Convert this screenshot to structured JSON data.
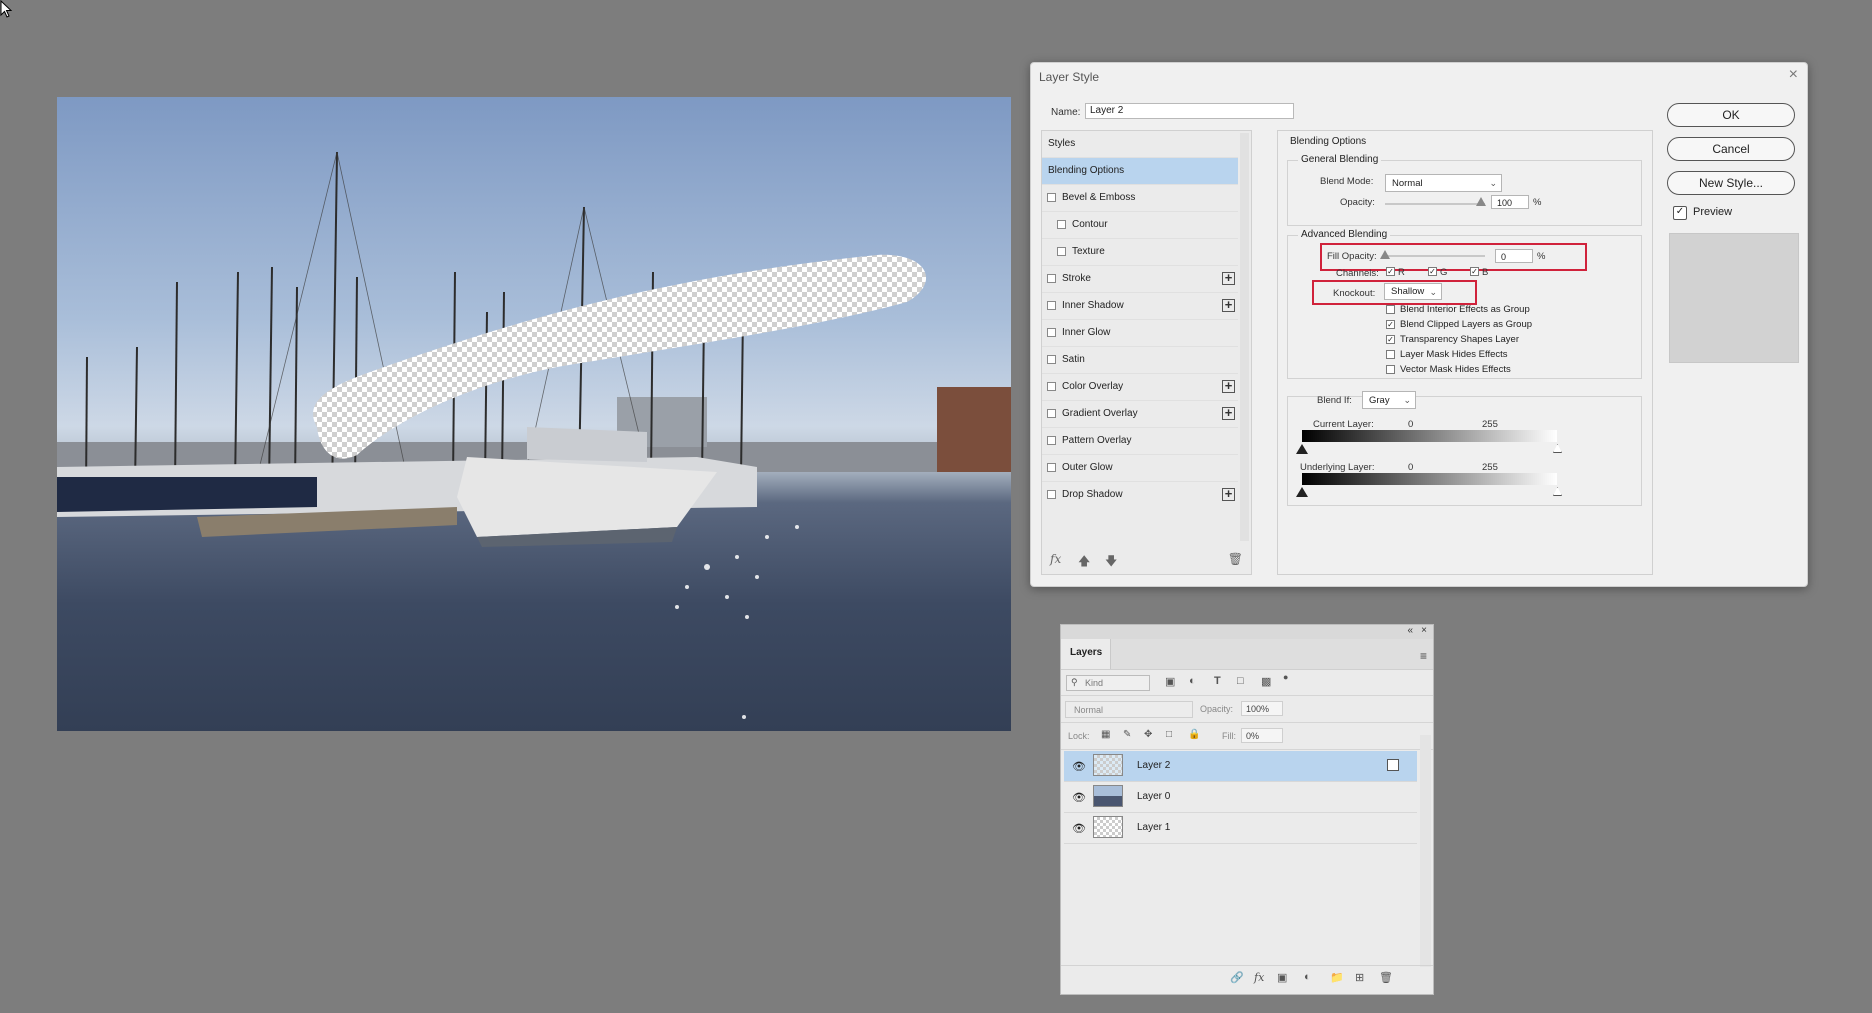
{
  "icons": {
    "cursor": "arrow-cursor",
    "dialog_close": "close-icon",
    "fx": "fx-icon",
    "move_up": "arrow-up-icon",
    "move_down": "arrow-down-icon",
    "trash": "trash-icon",
    "add": "plus-icon",
    "eye": "eye-icon",
    "search": "search-icon",
    "panel_menu": "hamburger-menu-icon",
    "collapse": "double-chevron-icon"
  },
  "dialog": {
    "title": "Layer Style",
    "close_glyph": "×",
    "name_label": "Name:",
    "name_value": "Layer 2",
    "styles_header": "Styles",
    "styles": [
      {
        "label": "Blending Options",
        "active": true
      },
      {
        "label": "Bevel & Emboss"
      },
      {
        "label": "Contour"
      },
      {
        "label": "Texture"
      },
      {
        "label": "Stroke"
      },
      {
        "label": "Inner Shadow"
      },
      {
        "label": "Inner Glow"
      },
      {
        "label": "Satin"
      },
      {
        "label": "Color Overlay"
      },
      {
        "label": "Gradient Overlay"
      },
      {
        "label": "Pattern Overlay"
      },
      {
        "label": "Outer Glow"
      },
      {
        "label": "Drop Shadow"
      }
    ],
    "plus_glyph": "+",
    "fx_glyph": "fx",
    "blending": {
      "section_title": "Blending Options",
      "general_title": "General Blending",
      "blend_mode_label": "Blend Mode:",
      "blend_mode_value": "Normal",
      "opacity_label": "Opacity:",
      "opacity_value": "100",
      "percent": "%",
      "advanced_title": "Advanced Blending",
      "fill_opacity_label": "Fill Opacity:",
      "fill_opacity_value": "0",
      "channels_label": "Channels:",
      "channel_r": "R",
      "channel_g": "G",
      "channel_b": "B",
      "knockout_label": "Knockout:",
      "knockout_value": "Shallow",
      "options": [
        {
          "label": "Blend Interior Effects as Group",
          "checked": false
        },
        {
          "label": "Blend Clipped Layers as Group",
          "checked": true
        },
        {
          "label": "Transparency Shapes Layer",
          "checked": true
        },
        {
          "label": "Layer Mask Hides Effects",
          "checked": false
        },
        {
          "label": "Vector Mask Hides Effects",
          "checked": false
        }
      ],
      "blend_if_label": "Blend If:",
      "blend_if_value": "Gray",
      "current_layer_label": "Current Layer:",
      "underlying_layer_label": "Underlying Layer:",
      "range_min": "0",
      "range_max": "255",
      "opacity_level": 1.0,
      "fill_opacity_level": 0.0
    },
    "buttons": {
      "ok": "OK",
      "cancel": "Cancel",
      "new_style": "New Style..."
    },
    "preview_label": "Preview",
    "preview_checked": true
  },
  "layers_panel": {
    "title": "Layers",
    "collapse_glyph": "«",
    "close_glyph": "×",
    "menu_glyph": "≡",
    "kind_placeholder": "Kind",
    "blend_mode": "Normal",
    "opacity_label": "Opacity:",
    "opacity_value": "100%",
    "lock_label": "Lock:",
    "fill_label": "Fill:",
    "fill_value": "0%",
    "layers": [
      {
        "name": "Layer 2",
        "active": true
      },
      {
        "name": "Layer 0",
        "active": false
      },
      {
        "name": "Layer 1",
        "active": false
      }
    ]
  },
  "colors": {
    "accent_selection": "#b9d4ee",
    "highlight_box": "#d0223b",
    "workspace_bg": "#7d7d7d"
  }
}
